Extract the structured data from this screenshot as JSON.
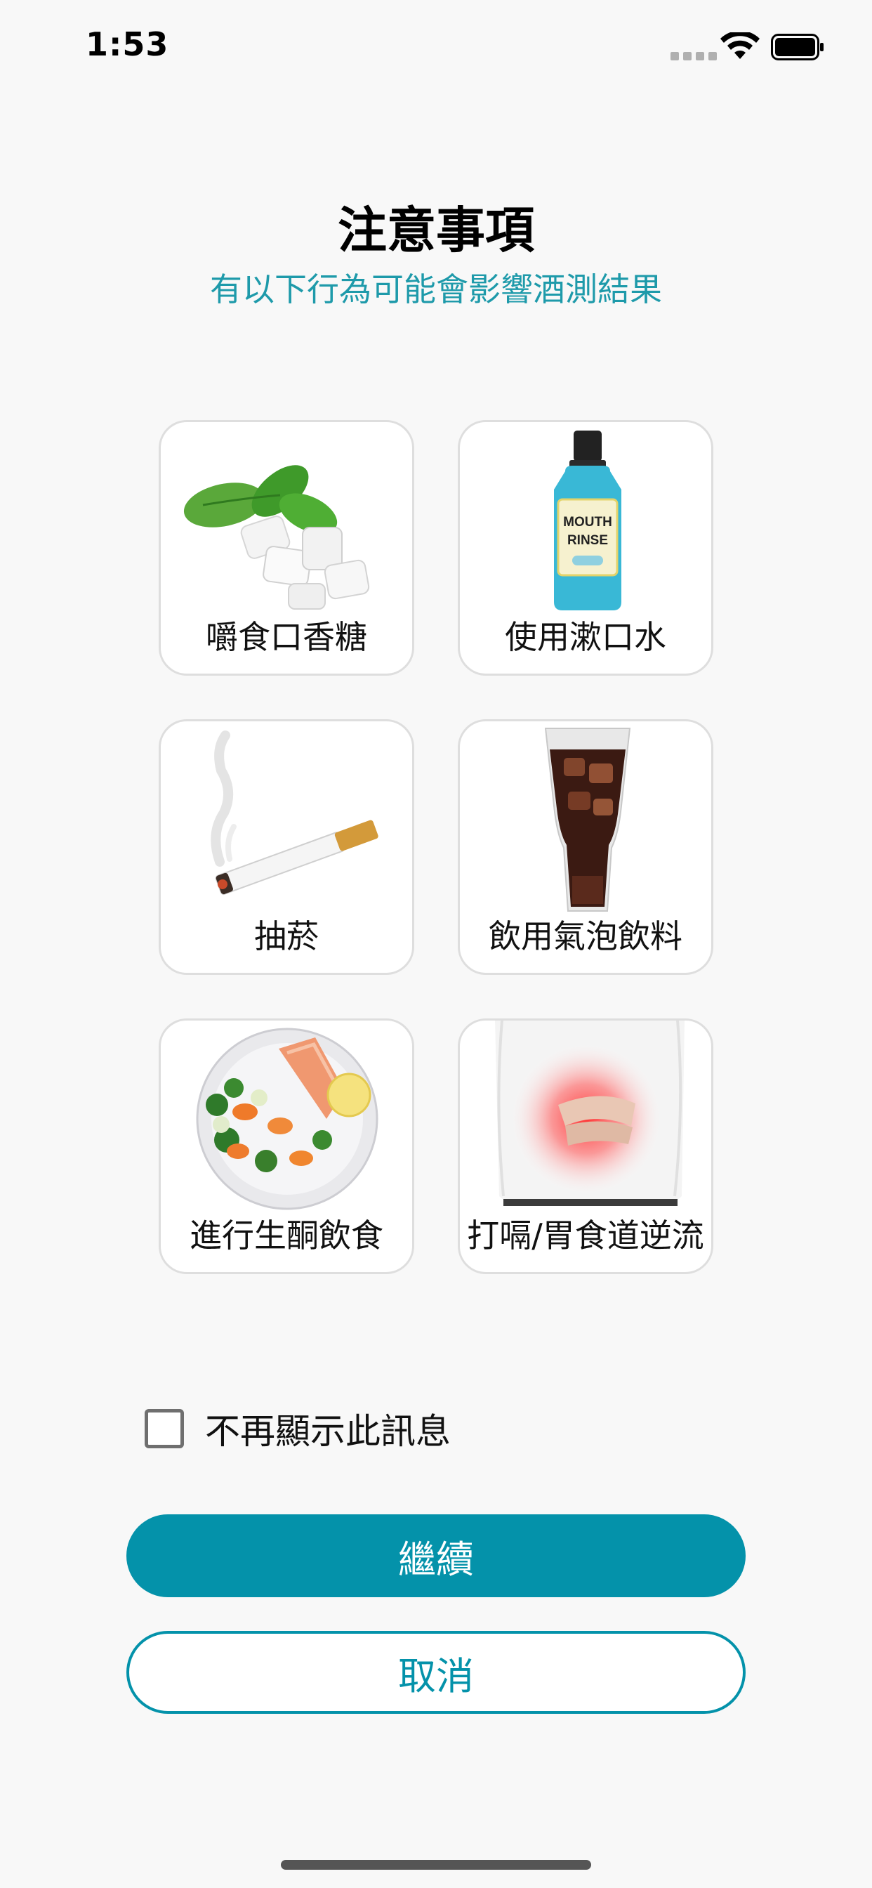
{
  "status_bar": {
    "time": "1:53"
  },
  "header": {
    "title": "注意事項",
    "subtitle": "有以下行為可能會影響酒測結果"
  },
  "items": [
    {
      "label": "嚼食口香糖",
      "icon": "chewing-gum-mint-icon"
    },
    {
      "label": "使用漱口水",
      "icon": "mouthwash-bottle-icon",
      "bottle_text_1": "MOUTH",
      "bottle_text_2": "RINSE"
    },
    {
      "label": "抽菸",
      "icon": "cigarette-icon"
    },
    {
      "label": "飲用氣泡飲料",
      "icon": "soda-glass-icon"
    },
    {
      "label": "進行生酮飲食",
      "icon": "keto-salmon-plate-icon"
    },
    {
      "label": "打嗝/胃食道逆流",
      "icon": "stomach-pain-icon"
    }
  ],
  "checkbox": {
    "label": "不再顯示此訊息",
    "checked": false
  },
  "buttons": {
    "continue": "繼續",
    "cancel": "取消"
  },
  "colors": {
    "accent": "#0492aa",
    "subtitle": "#1e9aaa",
    "background": "#f8f8f8"
  }
}
